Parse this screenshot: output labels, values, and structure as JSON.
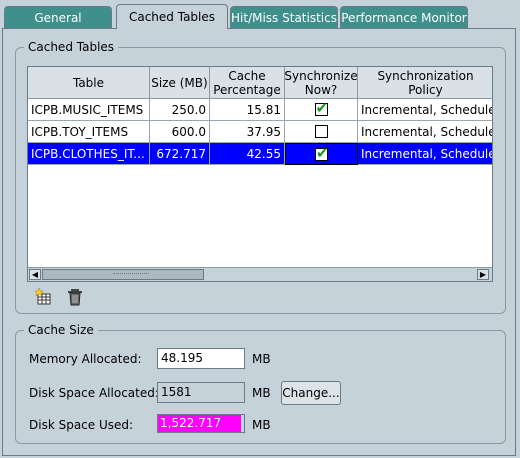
{
  "tabs": [
    {
      "label": "General"
    },
    {
      "label": "Cached Tables"
    },
    {
      "label": "Hit/Miss Statistics"
    },
    {
      "label": "Performance Monitor"
    }
  ],
  "cached_tables": {
    "legend": "Cached Tables",
    "columns": [
      "Table",
      "Size (MB)",
      "Cache\nPercentage",
      "Synchronize\nNow?",
      "Synchronization\nPolicy"
    ],
    "rows": [
      {
        "table": "ICPB.MUSIC_ITEMS",
        "size": "250.0",
        "cache_pct": "15.81",
        "sync_now": true,
        "policy": "Incremental, Scheduled"
      },
      {
        "table": "ICPB.TOY_ITEMS",
        "size": "600.0",
        "cache_pct": "37.95",
        "sync_now": false,
        "policy": "Incremental, Scheduled"
      },
      {
        "table": "ICPB.CLOTHES_IT...",
        "size": "672.717",
        "cache_pct": "42.55",
        "sync_now": true,
        "policy": "Incremental, Scheduled",
        "selected": true
      }
    ]
  },
  "cache_size": {
    "legend": "Cache Size",
    "memory_label": "Memory Allocated:",
    "memory_value": "48.195",
    "memory_unit": "MB",
    "disk_alloc_label": "Disk Space Allocated:",
    "disk_alloc_value": "1581",
    "disk_alloc_unit": "MB",
    "change_label": "Change...",
    "disk_used_label": "Disk Space Used:",
    "disk_used_value": "1,522.717",
    "disk_used_unit": "MB",
    "disk_used_fraction": 0.963,
    "disk_used_color": "#ff00ff"
  }
}
